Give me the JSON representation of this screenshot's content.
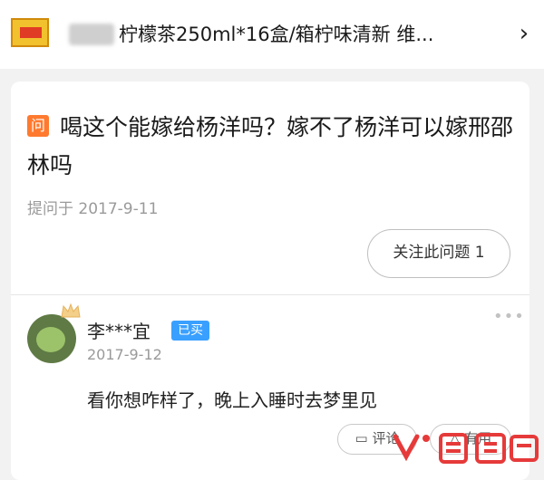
{
  "product": {
    "title": "柠檬茶250ml*16盒/箱柠味清新 维...",
    "chevron": "›"
  },
  "question": {
    "badge": "问",
    "text": "喝这个能嫁给杨洋吗？嫁不了杨洋可以嫁邢邵林吗",
    "date": "提问于 2017-9-11",
    "follow_label": "关注此问题 1"
  },
  "answer": {
    "username": "李***宜",
    "badge": "已买",
    "date": "2017-9-12",
    "text": "看你想咋样了，晚上入睡时去梦里见",
    "more": "•••",
    "comment_label": "评论",
    "useful_label": "有用"
  },
  "watermark": {
    "text": "人人都是产品经理"
  },
  "colors": {
    "question_badge": "#ff7a2f",
    "bought_badge": "#3aa0ff",
    "watermark_red": "#e63a3a"
  }
}
